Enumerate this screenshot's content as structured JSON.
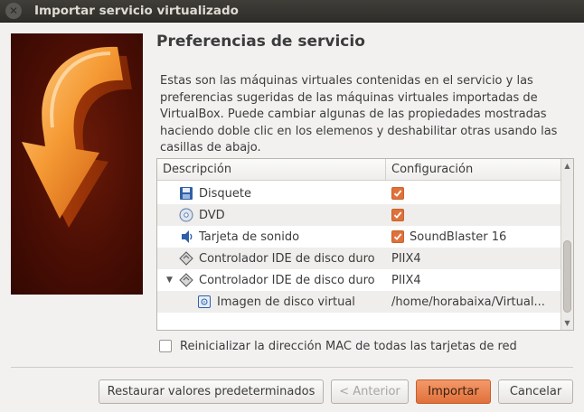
{
  "window": {
    "title": "Importar servicio virtualizado"
  },
  "heading": "Preferencias de servicio",
  "description": [
    "Estas son las máquinas virtuales contenidas en el servicio y las",
    "preferencias sugeridas de las máquinas virtuales importadas de",
    "VirtualBox. Puede cambiar algunas de las propiedades mostradas",
    "haciendo doble clic en los elemenos y deshabilitar otras usando las",
    "casillas de abajo."
  ],
  "table": {
    "columns": [
      "Descripción",
      "Configuración"
    ],
    "rows": [
      {
        "icon": "floppy-icon",
        "label": "Disquete",
        "checked": true,
        "value": ""
      },
      {
        "icon": "dvd-icon",
        "label": "DVD",
        "checked": true,
        "value": ""
      },
      {
        "icon": "audio-card-icon",
        "label": "Tarjeta de sonido",
        "checked": true,
        "value": "SoundBlaster 16"
      },
      {
        "icon": "ide-controller-icon",
        "label": "Controlador IDE de disco duro",
        "checked": false,
        "value": "PIIX4"
      },
      {
        "icon": "ide-controller-icon",
        "label": "Controlador IDE de disco duro",
        "checked": false,
        "value": "PIIX4",
        "expanded": true
      },
      {
        "icon": "hard-disk-image-icon",
        "label": "Imagen de disco virtual",
        "checked": false,
        "value": "/home/horabaixa/Virtual..."
      }
    ]
  },
  "options": {
    "mac_label": "Reinicializar la dirección MAC de todas las tarjetas de red",
    "mac_checked": false
  },
  "buttons": {
    "restore": "Restaurar valores predeterminados",
    "back": "< Anterior",
    "import": "Importar",
    "cancel": "Cancelar"
  },
  "colors": {
    "accent": "#e0713a",
    "titlebar": "#3c3b37"
  }
}
